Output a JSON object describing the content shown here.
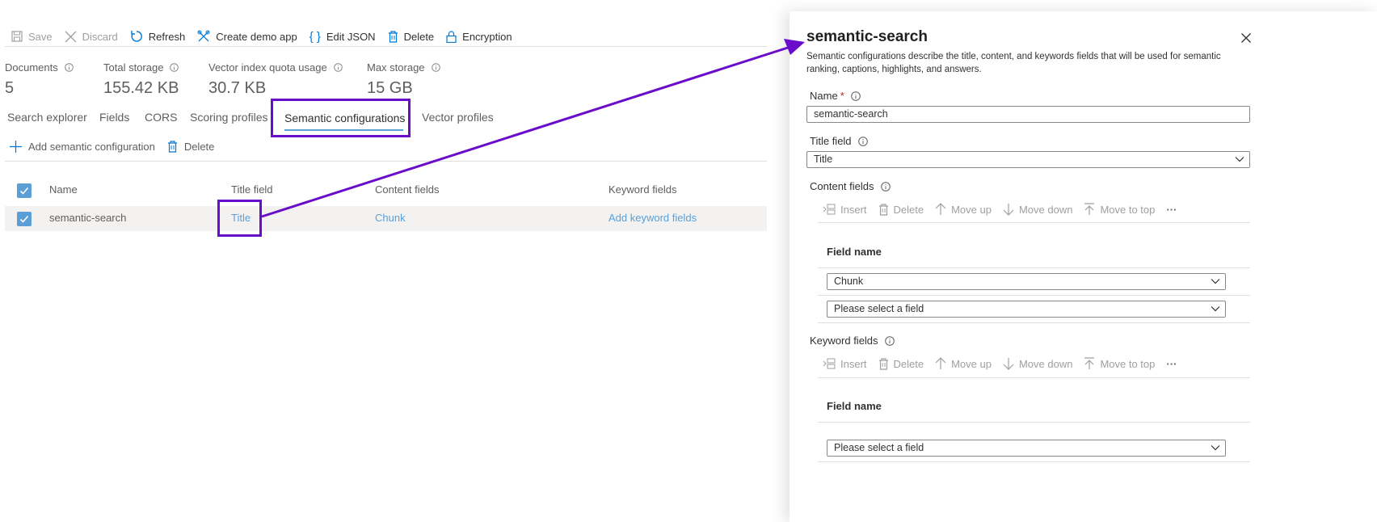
{
  "toolbar": {
    "save": "Save",
    "discard": "Discard",
    "refresh": "Refresh",
    "create_demo_app": "Create demo app",
    "edit_json": "Edit JSON",
    "delete": "Delete",
    "encryption": "Encryption"
  },
  "stats": [
    {
      "label": "Documents",
      "value": "5"
    },
    {
      "label": "Total storage",
      "value": "155.42 KB"
    },
    {
      "label": "Vector index quota usage",
      "value": "30.7 KB"
    },
    {
      "label": "Max storage",
      "value": "15 GB"
    }
  ],
  "tabs": [
    "Search explorer",
    "Fields",
    "CORS",
    "Scoring profiles",
    "Semantic configurations",
    "Vector profiles"
  ],
  "selected_tab": "Semantic configurations",
  "commands": {
    "add": "Add semantic configuration",
    "delete": "Delete"
  },
  "table": {
    "headers": [
      "Name",
      "Title field",
      "Content fields",
      "Keyword fields"
    ],
    "row": {
      "name": "semantic-search",
      "title_field": "Title",
      "content_fields": "Chunk",
      "keyword_fields": "Add keyword fields"
    }
  },
  "panel": {
    "title": "semantic-search",
    "description": "Semantic configurations describe the title, content, and keywords fields that will be used for semantic ranking, captions, highlights, and answers.",
    "name_label": "Name",
    "required_mark": "*",
    "name_value": "semantic-search",
    "title_field_label": "Title field",
    "title_field_value": "Title",
    "content_fields_label": "Content fields",
    "keyword_fields_label": "Keyword fields",
    "cmd": {
      "insert": "Insert",
      "delete": "Delete",
      "move_up": "Move up",
      "move_down": "Move down",
      "move_to_top": "Move to top",
      "more": "···"
    },
    "field_name_header": "Field name",
    "content_field_values": [
      "Chunk",
      "Please select a field"
    ],
    "keyword_field_values": [
      "Please select a field"
    ]
  },
  "colors": {
    "accent": "#6a0dca",
    "link": "#5b9fd6",
    "checkbox": "#5b9fd6",
    "selected_tab_underline": "#5b9fd6"
  }
}
